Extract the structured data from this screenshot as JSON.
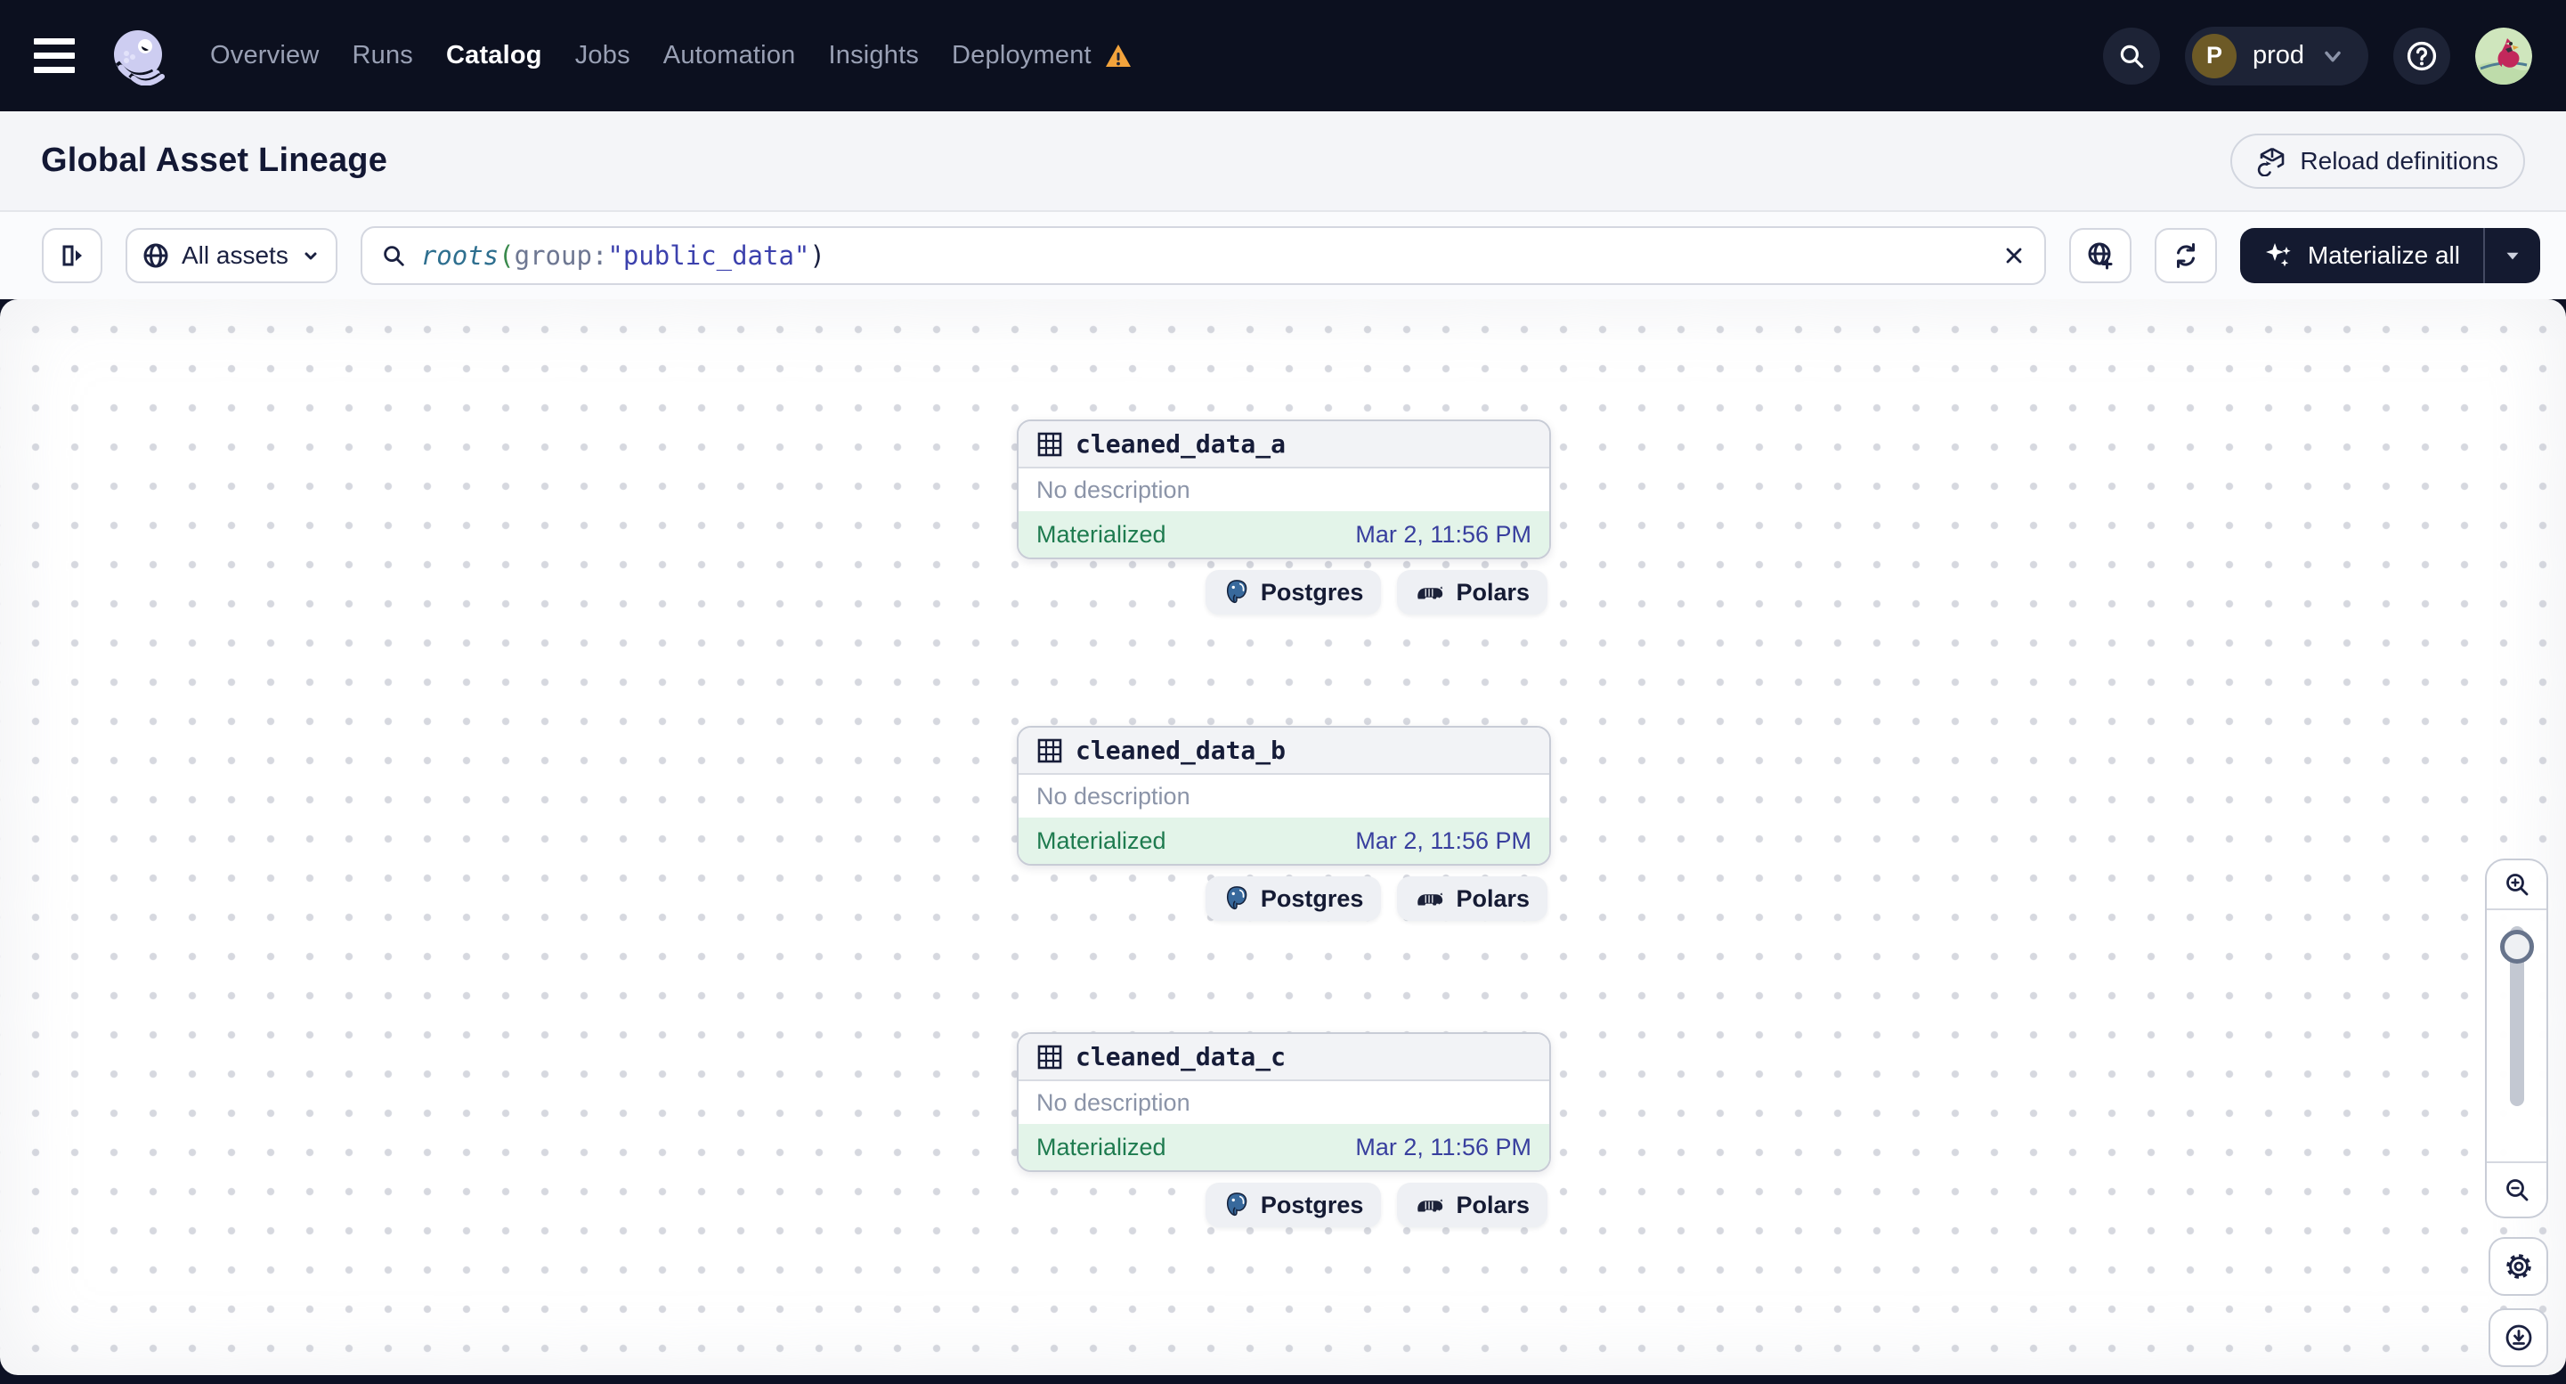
{
  "nav": {
    "items": [
      {
        "label": "Overview",
        "active": false
      },
      {
        "label": "Runs",
        "active": false
      },
      {
        "label": "Catalog",
        "active": true
      },
      {
        "label": "Jobs",
        "active": false
      },
      {
        "label": "Automation",
        "active": false
      },
      {
        "label": "Insights",
        "active": false
      },
      {
        "label": "Deployment",
        "active": false,
        "warning": true
      }
    ],
    "icons": [
      "hamburger-icon",
      "dagster-logo",
      "warning-icon",
      "search-icon",
      "chevron-down-icon",
      "help-icon",
      "avatar"
    ],
    "deployment_switcher": {
      "initial": "P",
      "label": "prod"
    }
  },
  "header": {
    "title": "Global Asset Lineage",
    "reload_button": {
      "label": "Reload definitions",
      "icon": "reload-definitions-icon"
    }
  },
  "toolbar": {
    "panel_toggle_icon": "open-panel-icon",
    "filter_button": {
      "label": "All assets",
      "icon": "globe-icon"
    },
    "search": {
      "value": "roots(group:\"public_data\")",
      "parts": [
        {
          "text": "roots",
          "type": "function"
        },
        {
          "text": "(",
          "type": "paren-open"
        },
        {
          "text": "group",
          "type": "key"
        },
        {
          "text": ":",
          "type": "key"
        },
        {
          "text": "\"public_data\"",
          "type": "string"
        },
        {
          "text": ")",
          "type": "paren-close"
        }
      ],
      "clear_icon": "clear-icon"
    },
    "buttons": [
      {
        "icon": "globe-plus-icon"
      },
      {
        "icon": "refresh-icon"
      }
    ],
    "materialize_button": {
      "label": "Materialize all",
      "icon": "sparkles-icon",
      "caret": "caret-down-icon"
    }
  },
  "graph": {
    "nodes": [
      {
        "name": "cleaned_data_a",
        "description": "No description",
        "status": "Materialized",
        "timestamp": "Mar 2, 11:56 PM",
        "tags": [
          {
            "label": "Postgres",
            "icon": "postgres-icon"
          },
          {
            "label": "Polars",
            "icon": "polars-icon"
          }
        ]
      },
      {
        "name": "cleaned_data_b",
        "description": "No description",
        "status": "Materialized",
        "timestamp": "Mar 2, 11:56 PM",
        "tags": [
          {
            "label": "Postgres",
            "icon": "postgres-icon"
          },
          {
            "label": "Polars",
            "icon": "polars-icon"
          }
        ]
      },
      {
        "name": "cleaned_data_c",
        "description": "No description",
        "status": "Materialized",
        "timestamp": "Mar 2, 11:56 PM",
        "tags": [
          {
            "label": "Postgres",
            "icon": "postgres-icon"
          },
          {
            "label": "Polars",
            "icon": "polars-icon"
          }
        ]
      }
    ]
  },
  "zoom_controls": {
    "icons": [
      "zoom-in-icon",
      "zoom-slider",
      "zoom-out-icon",
      "settings-gear-icon",
      "download-icon"
    ]
  },
  "colors": {
    "nav_bg": "#0c101f",
    "status_green_text": "#1e7b4f",
    "status_green_bg": "#e3f4e9",
    "timestamp_blue": "#383f9e",
    "warning_amber": "#f2a33c",
    "query_function": "#2e6f8f",
    "query_string": "#3c41ad"
  }
}
